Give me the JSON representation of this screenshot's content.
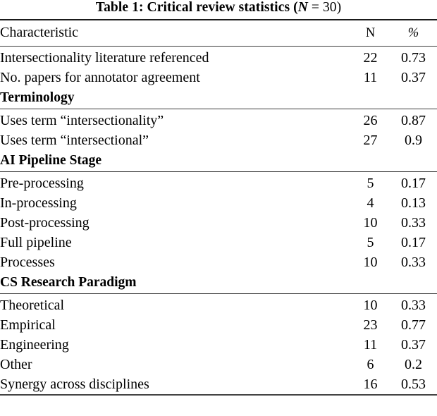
{
  "caption": {
    "prefix": "Table 1: Critical review statistics (",
    "n_symbol": "N",
    "tail": " = 30)"
  },
  "table": {
    "columns": [
      {
        "key": "characteristic",
        "label": "Characteristic",
        "align": "left"
      },
      {
        "key": "n",
        "label": "N",
        "align": "center"
      },
      {
        "key": "pct",
        "label": "%",
        "align": "center"
      }
    ],
    "total_n": 30,
    "sections": [
      {
        "heading": null,
        "rows": [
          {
            "characteristic": "Intersectionality literature referenced",
            "n": "22",
            "pct": "0.73"
          },
          {
            "characteristic": "No. papers for annotator agreement",
            "n": "11",
            "pct": "0.37"
          }
        ]
      },
      {
        "heading": "Terminology",
        "rows": [
          {
            "characteristic": "Uses term “intersectionality”",
            "n": "26",
            "pct": "0.87"
          },
          {
            "characteristic": "Uses term “intersectional”",
            "n": "27",
            "pct": "0.9"
          }
        ]
      },
      {
        "heading": "AI Pipeline Stage",
        "rows": [
          {
            "characteristic": "Pre-processing",
            "n": "5",
            "pct": "0.17"
          },
          {
            "characteristic": "In-processing",
            "n": "4",
            "pct": "0.13"
          },
          {
            "characteristic": "Post-processing",
            "n": "10",
            "pct": "0.33"
          },
          {
            "characteristic": "Full pipeline",
            "n": "5",
            "pct": "0.17"
          },
          {
            "characteristic": "Processes",
            "n": "10",
            "pct": "0.33"
          }
        ]
      },
      {
        "heading": "CS Research Paradigm",
        "rows": [
          {
            "characteristic": "Theoretical",
            "n": "10",
            "pct": "0.33"
          },
          {
            "characteristic": "Empirical",
            "n": "23",
            "pct": "0.77"
          },
          {
            "characteristic": "Engineering",
            "n": "11",
            "pct": "0.37"
          },
          {
            "characteristic": "Other",
            "n": "6",
            "pct": "0.2"
          },
          {
            "characteristic": "Synergy across disciplines",
            "n": "16",
            "pct": "0.53"
          }
        ]
      }
    ]
  },
  "chart_data": {
    "type": "table",
    "title": "Table 1: Critical review statistics (N = 30)",
    "columns": [
      "Characteristic",
      "N",
      "%"
    ],
    "rows": [
      [
        "Intersectionality literature referenced",
        22,
        0.73
      ],
      [
        "No. papers for annotator agreement",
        11,
        0.37
      ],
      [
        "Terminology",
        null,
        null
      ],
      [
        "Uses term “intersectionality”",
        26,
        0.87
      ],
      [
        "Uses term “intersectional”",
        27,
        0.9
      ],
      [
        "AI Pipeline Stage",
        null,
        null
      ],
      [
        "Pre-processing",
        5,
        0.17
      ],
      [
        "In-processing",
        4,
        0.13
      ],
      [
        "Post-processing",
        10,
        0.33
      ],
      [
        "Full pipeline",
        5,
        0.17
      ],
      [
        "Processes",
        10,
        0.33
      ],
      [
        "CS Research Paradigm",
        null,
        null
      ],
      [
        "Theoretical",
        10,
        0.33
      ],
      [
        "Empirical",
        23,
        0.77
      ],
      [
        "Engineering",
        11,
        0.37
      ],
      [
        "Other",
        6,
        0.2
      ],
      [
        "Synergy across disciplines",
        16,
        0.53
      ]
    ]
  }
}
